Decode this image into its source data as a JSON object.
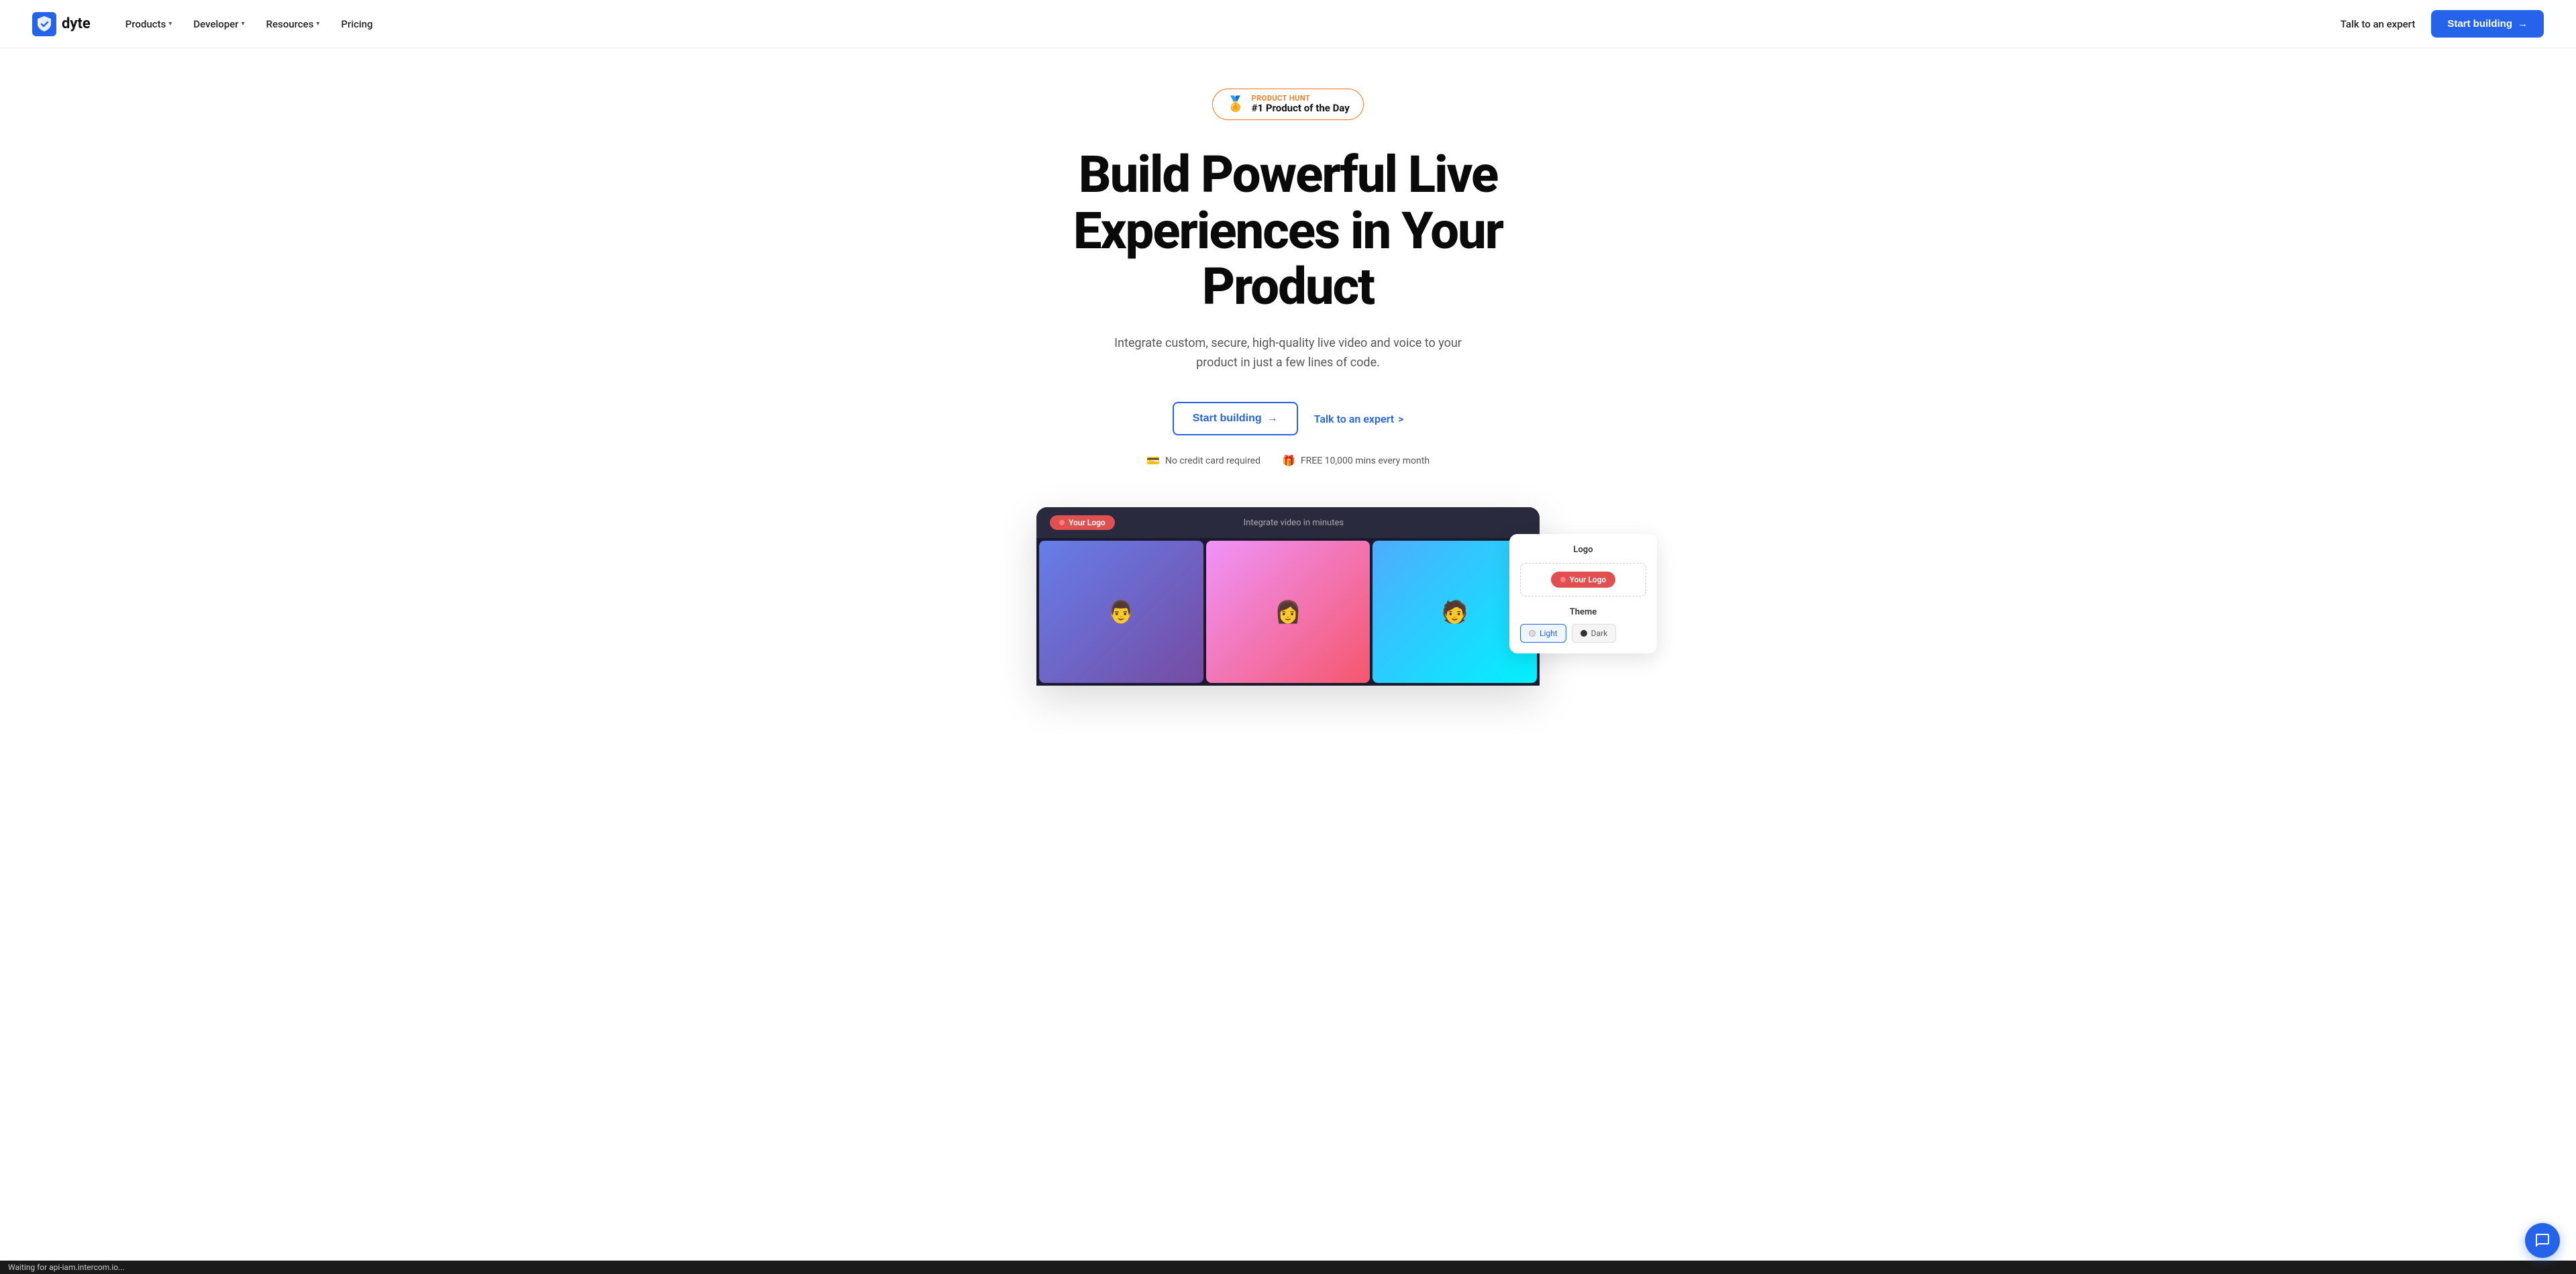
{
  "nav": {
    "logo_text": "dyte",
    "items": [
      {
        "label": "Products",
        "has_dropdown": true
      },
      {
        "label": "Developer",
        "has_dropdown": true
      },
      {
        "label": "Resources",
        "has_dropdown": true
      },
      {
        "label": "Pricing",
        "has_dropdown": false
      }
    ],
    "talk_expert_label": "Talk to an expert",
    "start_building_label": "Start building",
    "start_building_arrow": "→"
  },
  "hero": {
    "badge": {
      "icon": "🏅",
      "eyebrow": "PRODUCT HUNT",
      "text": "#1 Product of the Day"
    },
    "title_line1": "Build Powerful Live",
    "title_line2": "Experiences in Your Product",
    "subtitle": "Integrate custom, secure, high-quality live video and voice to your product in just a few lines of code.",
    "start_building_label": "Start building",
    "start_building_arrow": "→",
    "talk_expert_label": "Talk to an expert",
    "talk_expert_arrow": ">",
    "perks": [
      {
        "icon": "💳",
        "text": "No credit card required"
      },
      {
        "icon": "🎁",
        "text": "FREE 10,000 mins every month"
      }
    ]
  },
  "demo": {
    "logo_label": "Your Logo",
    "integrate_label": "Integrate video in minutes",
    "settings_panel": {
      "logo_section": "Logo",
      "logo_preview_label": "Your Logo",
      "theme_section": "Theme",
      "theme_options": [
        {
          "label": "Light",
          "active": true
        },
        {
          "label": "Dark",
          "active": false
        }
      ]
    }
  },
  "status_bar": {
    "text": "Waiting for api-iam.intercom.io..."
  },
  "chat_button": {
    "label": "Chat"
  }
}
